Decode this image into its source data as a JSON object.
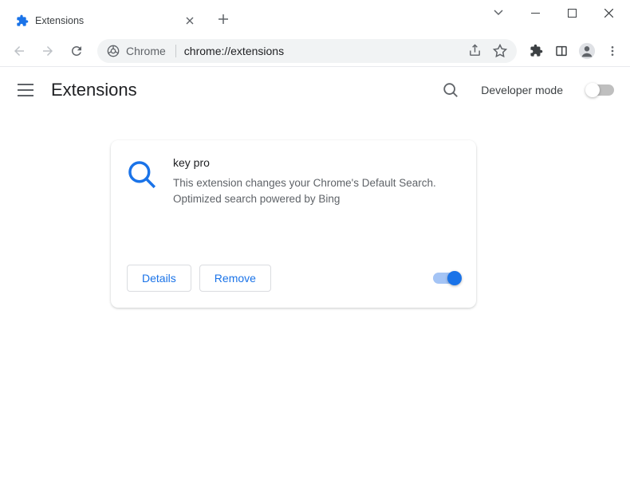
{
  "window": {
    "tab_title": "Extensions"
  },
  "omnibox": {
    "chip_label": "Chrome",
    "url": "chrome://extensions"
  },
  "page": {
    "title": "Extensions",
    "developer_mode_label": "Developer mode"
  },
  "extension": {
    "name": "key pro",
    "description": "This extension changes your Chrome's Default Search. Optimized search powered by Bing",
    "details_label": "Details",
    "remove_label": "Remove",
    "enabled": true
  }
}
